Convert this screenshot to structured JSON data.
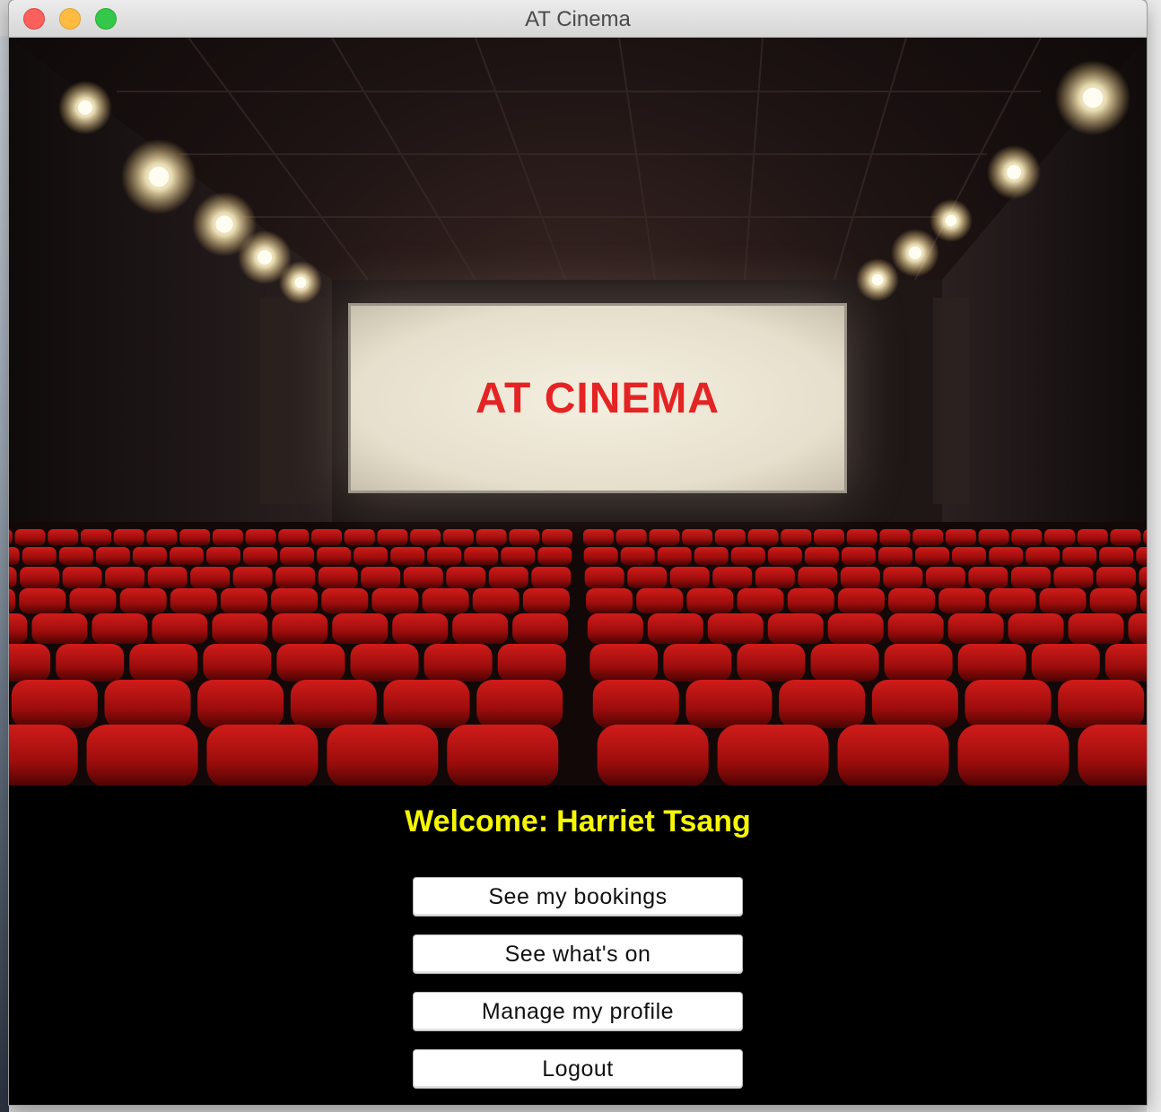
{
  "window": {
    "title": "AT Cinema"
  },
  "hero": {
    "screen_text": "AT CINEMA"
  },
  "welcome": {
    "label": "Welcome:",
    "user_name": "Harriet Tsang"
  },
  "menu": {
    "bookings_label": "See my bookings",
    "whats_on_label": "See what's on",
    "profile_label": "Manage my profile",
    "logout_label": "Logout"
  },
  "colors": {
    "welcome_text": "#f5f700",
    "screen_text": "#e42424",
    "panel_bg": "#000000",
    "seat_red": "#b3100f"
  }
}
